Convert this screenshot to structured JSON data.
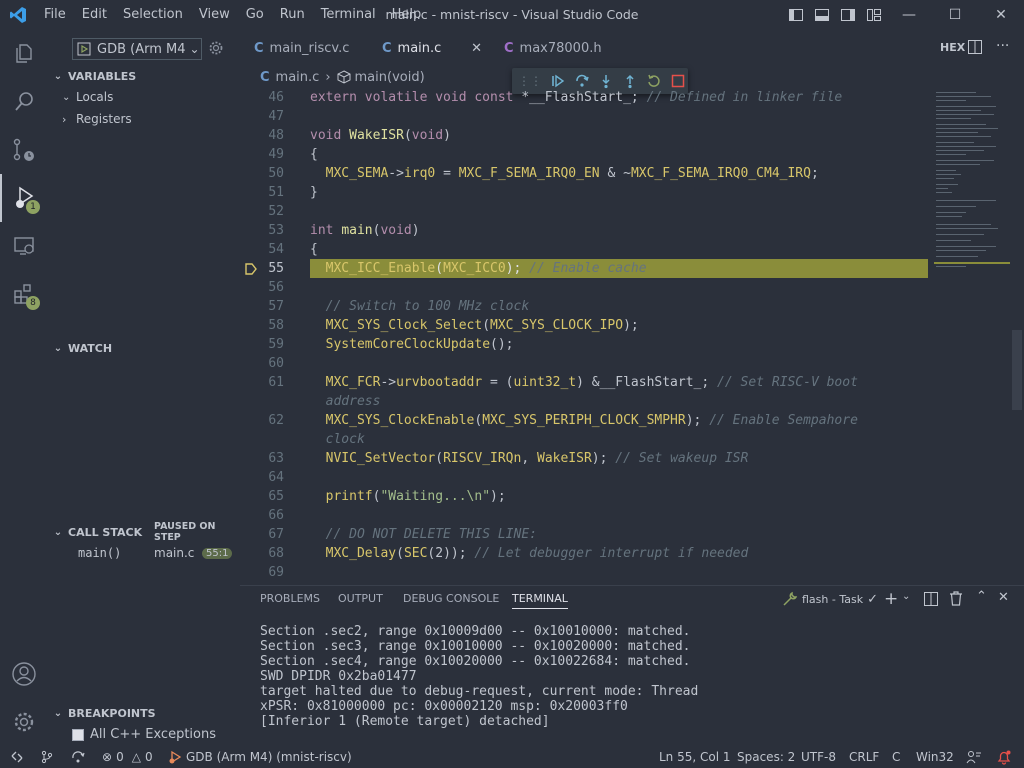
{
  "window": {
    "title": "main.c - mnist-riscv - Visual Studio Code",
    "menu": [
      "File",
      "Edit",
      "Selection",
      "View",
      "Go",
      "Run",
      "Terminal",
      "Help"
    ]
  },
  "activity": {
    "debug_badge": "1",
    "extensions_badge": "8"
  },
  "sidebar": {
    "debug_config": "GDB (Arm M4",
    "variables_header": "VARIABLES",
    "variables_items": [
      "Locals",
      "Registers"
    ],
    "watch_header": "WATCH",
    "callstack_header": "CALL STACK",
    "callstack_status": "PAUSED ON STEP",
    "callstack_frame": {
      "name": "main()",
      "file": "main.c",
      "pos": "55:1"
    },
    "breakpoints_header": "BREAKPOINTS",
    "breakpoint_item": "All C++ Exceptions"
  },
  "tabs": [
    {
      "label": "main_riscv.c",
      "icon": "C"
    },
    {
      "label": "main.c",
      "icon": "C"
    },
    {
      "label": "max78000.h",
      "icon": "C"
    }
  ],
  "editor_actions": {
    "hex": "HEX"
  },
  "breadcrumb": {
    "file": "main.c",
    "symbol": "main(void)"
  },
  "code": [
    {
      "n": "46",
      "html": "<span class=\"kw\">extern volatile void const</span> *__FlashStart_; <span class=\"cm\">// Defined in linker file</span>"
    },
    {
      "n": "47",
      "html": ""
    },
    {
      "n": "48",
      "html": "<span class=\"kw\">void</span> <span class=\"fn\">WakeISR</span>(<span class=\"kw\">void</span>)"
    },
    {
      "n": "49",
      "html": "{"
    },
    {
      "n": "50",
      "html": "  <span class=\"id\">MXC_SEMA</span>-><span class=\"id\">irq0</span> = <span class=\"id\">MXC_F_SEMA_IRQ0_EN</span> &amp; ~<span class=\"id\">MXC_F_SEMA_IRQ0_CM4_IRQ</span>;"
    },
    {
      "n": "51",
      "html": "}"
    },
    {
      "n": "52",
      "html": ""
    },
    {
      "n": "53",
      "html": "<span class=\"kw\">int</span> <span class=\"fn\">main</span>(<span class=\"kw\">void</span>)"
    },
    {
      "n": "54",
      "html": "{"
    },
    {
      "n": "55",
      "html": "  <span class=\"id\">MXC_ICC_Enable</span>(<span class=\"id\">MXC_ICC0</span>); <span class=\"cm\">// Enable cache</span>"
    },
    {
      "n": "56",
      "html": ""
    },
    {
      "n": "57",
      "html": "  <span class=\"cm\">// Switch to 100 MHz clock</span>"
    },
    {
      "n": "58",
      "html": "  <span class=\"id\">MXC_SYS_Clock_Select</span>(<span class=\"id\">MXC_SYS_CLOCK_IPO</span>);"
    },
    {
      "n": "59",
      "html": "  <span class=\"id\">SystemCoreClockUpdate</span>();"
    },
    {
      "n": "60",
      "html": ""
    },
    {
      "n": "61",
      "html": "  <span class=\"id\">MXC_FCR</span>-><span class=\"id\">urvbootaddr</span> = (<span class=\"id\">uint32_t</span>) &amp;__FlashStart_; <span class=\"cm\">// Set RISC-V boot</span>"
    },
    {
      "n": "",
      "html": "  <span class=\"cm\">address</span>"
    },
    {
      "n": "62",
      "html": "  <span class=\"id\">MXC_SYS_ClockEnable</span>(<span class=\"id\">MXC_SYS_PERIPH_CLOCK_SMPHR</span>); <span class=\"cm\">// Enable Sempahore</span>"
    },
    {
      "n": "",
      "html": "  <span class=\"cm\">clock</span>"
    },
    {
      "n": "63",
      "html": "  <span class=\"id\">NVIC_SetVector</span>(<span class=\"id\">RISCV_IRQn</span>, <span class=\"id\">WakeISR</span>); <span class=\"cm\">// Set wakeup ISR</span>"
    },
    {
      "n": "64",
      "html": ""
    },
    {
      "n": "65",
      "html": "  <span class=\"id\">printf</span>(<span class=\"str\">\"Waiting...\\n\"</span>);"
    },
    {
      "n": "66",
      "html": ""
    },
    {
      "n": "67",
      "html": "  <span class=\"cm\">// DO NOT DELETE THIS LINE:</span>"
    },
    {
      "n": "68",
      "html": "  <span class=\"id\">MXC_Delay</span>(<span class=\"id\">SEC</span>(2)); <span class=\"cm\">// Let debugger interrupt if needed</span>"
    },
    {
      "n": "69",
      "html": ""
    }
  ],
  "panel": {
    "tabs": [
      "PROBLEMS",
      "OUTPUT",
      "DEBUG CONSOLE",
      "TERMINAL"
    ],
    "task": "flash - Task",
    "terminal": [
      "Section .sec2, range 0x10009d00 -- 0x10010000: matched.",
      "Section .sec3, range 0x10010000 -- 0x10020000: matched.",
      "Section .sec4, range 0x10020000 -- 0x10022684: matched.",
      "SWD DPIDR 0x2ba01477",
      "target halted due to debug-request, current mode: Thread",
      "xPSR: 0x81000000 pc: 0x00002120 msp: 0x20003ff0",
      "[Inferior 1 (Remote target) detached]"
    ]
  },
  "status": {
    "errors": "0",
    "warnings": "0",
    "debug": "GDB (Arm M4) (mnist-riscv)",
    "position": "Ln 55, Col 1",
    "spaces": "Spaces: 2",
    "encoding": "UTF-8",
    "eol": "CRLF",
    "language": "C",
    "platform": "Win32"
  },
  "colors": {
    "accent": "#007acc",
    "highlight": "#8a8d3a",
    "badge": "#8ea262"
  }
}
